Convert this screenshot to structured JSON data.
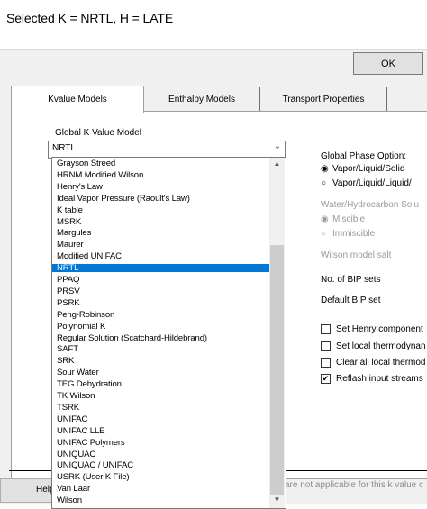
{
  "caption": "Selected K = NRTL, H = LATE",
  "dialog": {
    "ok_label": "OK",
    "tabs": [
      {
        "label": "Kvalue Models"
      },
      {
        "label": "Enthalpy Models"
      },
      {
        "label": "Transport Properties"
      }
    ],
    "help_label": "Help",
    "footnote": "are not applicable for this k value c"
  },
  "kvalue": {
    "global_label": "Global K Value Model",
    "selected": "NRTL",
    "options": [
      "Grayson Streed",
      "HRNM Modified Wilson",
      "Henry's Law",
      "Ideal Vapor Pressure (Raoult's Law)",
      "K table",
      "MSRK",
      "Margules",
      "Maurer",
      "Modified UNIFAC",
      "NRTL",
      "PPAQ",
      "PRSV",
      "PSRK",
      "Peng-Robinson",
      "Polynomial K",
      "Regular Solution (Scatchard-Hildebrand)",
      "SAFT",
      "SRK",
      "Sour Water",
      "TEG Dehydration",
      "TK Wilson",
      "TSRK",
      "UNIFAC",
      "UNIFAC LLE",
      "UNIFAC Polymers",
      "UNIQUAC",
      "UNIQUAC / UNIFAC",
      "USRK (User K File)",
      "Van Laar",
      "Wilson"
    ],
    "selected_index": 9
  },
  "phase": {
    "label": "Global Phase Option:",
    "options": [
      "Vapor/Liquid/Solid",
      "Vapor/Liquid/Liquid/"
    ],
    "checked_index": 0
  },
  "water": {
    "label": "Water/Hydrocarbon Solu",
    "options": [
      "Miscible",
      "Immiscible"
    ],
    "checked_index": 0
  },
  "wilson_label": "Wilson model salt",
  "bip_sets_label": "No. of BIP sets",
  "default_bip_label": "Default BIP set",
  "checkboxes": [
    {
      "label": "Set Henry component",
      "checked": false
    },
    {
      "label": "Set local thermodynan",
      "checked": false
    },
    {
      "label": "Clear all local thermod",
      "checked": false
    },
    {
      "label": "Reflash input streams",
      "checked": true
    }
  ],
  "glyphs": {
    "dropdown_arrow": "⌄",
    "scroll_up": "▲",
    "scroll_down": "▼",
    "radio_on": "◉",
    "radio_off": "○",
    "check_mark": "✔"
  }
}
